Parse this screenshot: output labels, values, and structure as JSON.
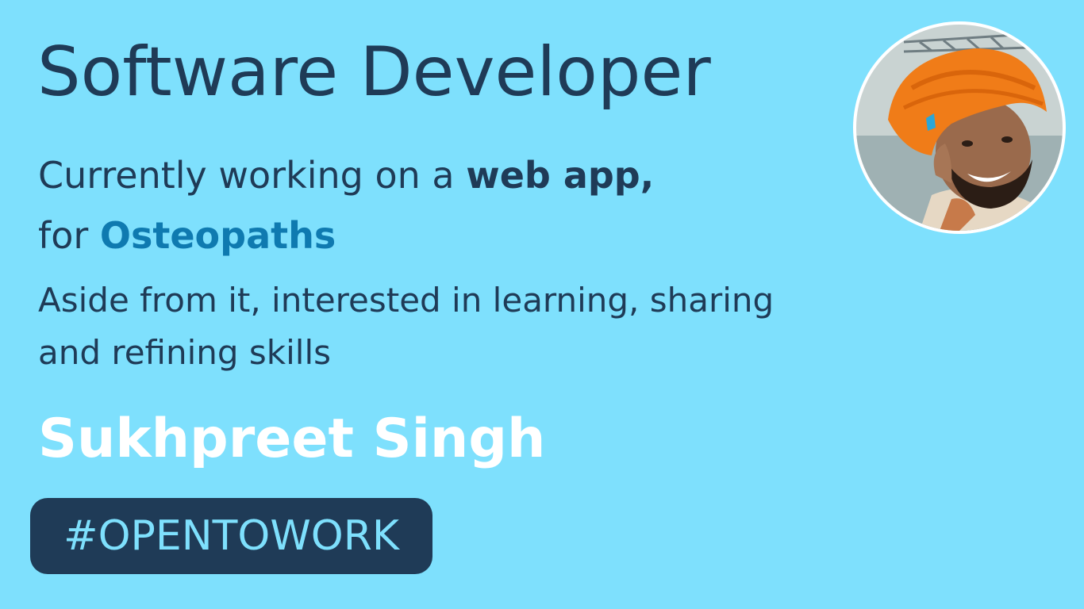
{
  "headline": "Software Developer",
  "intro": {
    "prefix": "Currently working on a ",
    "emphasis": "web app,",
    "line2_prefix": "for ",
    "audience": "Osteopaths"
  },
  "aside": {
    "line1": "Aside from it, interested in learning, sharing",
    "line2": "and refining skills"
  },
  "name": "Sukhpreet Singh",
  "badge": "#OPENTOWORK",
  "avatar": {
    "description_icon": "profile-photo"
  },
  "colors": {
    "background": "#7ee0fd",
    "text": "#1f3b57",
    "accent": "#0f7ab0",
    "name": "#ffffff",
    "badge_bg": "#1f3b57",
    "badge_text": "#7ee0fd"
  }
}
